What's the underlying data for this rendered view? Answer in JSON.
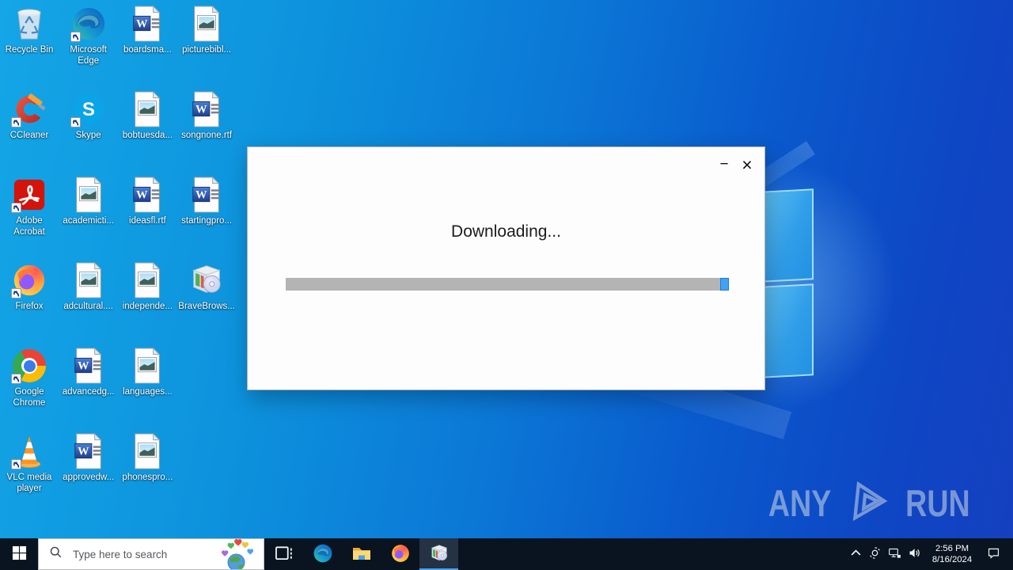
{
  "desktop_icons": [
    {
      "name": "recycle-bin",
      "label": "Recycle Bin",
      "type": "recycle-bin",
      "shortcut": false,
      "col": 1,
      "row": 1
    },
    {
      "name": "microsoft-edge",
      "label": "Microsoft Edge",
      "type": "edge",
      "shortcut": true,
      "col": 2,
      "row": 1
    },
    {
      "name": "boardsma-doc",
      "label": "boardsma...",
      "type": "word",
      "shortcut": false,
      "col": 3,
      "row": 1
    },
    {
      "name": "picturebibl-image",
      "label": "picturebibl...",
      "type": "image",
      "shortcut": false,
      "col": 4,
      "row": 1
    },
    {
      "name": "ccleaner",
      "label": "CCleaner",
      "type": "ccleaner",
      "shortcut": true,
      "col": 1,
      "row": 2
    },
    {
      "name": "skype",
      "label": "Skype",
      "type": "skype",
      "shortcut": true,
      "col": 2,
      "row": 2
    },
    {
      "name": "bobtuesda-image",
      "label": "bobtuesda...",
      "type": "image",
      "shortcut": false,
      "col": 3,
      "row": 2
    },
    {
      "name": "songnone-rtf",
      "label": "songnone.rtf",
      "type": "word",
      "shortcut": false,
      "col": 4,
      "row": 2
    },
    {
      "name": "adobe-acrobat",
      "label": "Adobe Acrobat",
      "type": "acrobat",
      "shortcut": true,
      "col": 1,
      "row": 3
    },
    {
      "name": "academicti-image",
      "label": "academicti...",
      "type": "image",
      "shortcut": false,
      "col": 2,
      "row": 3
    },
    {
      "name": "ideasfl-rtf",
      "label": "ideasfl.rtf",
      "type": "word",
      "shortcut": false,
      "col": 3,
      "row": 3
    },
    {
      "name": "startingpro-doc",
      "label": "startingpro...",
      "type": "word",
      "shortcut": false,
      "col": 4,
      "row": 3
    },
    {
      "name": "firefox",
      "label": "Firefox",
      "type": "firefox",
      "shortcut": true,
      "col": 1,
      "row": 4
    },
    {
      "name": "adcultural-image",
      "label": "adcultural....",
      "type": "image",
      "shortcut": false,
      "col": 2,
      "row": 4
    },
    {
      "name": "independe-image",
      "label": "independe...",
      "type": "image",
      "shortcut": false,
      "col": 3,
      "row": 4
    },
    {
      "name": "bravebrowser-installer",
      "label": "BraveBrows...",
      "type": "installer",
      "shortcut": false,
      "col": 4,
      "row": 4
    },
    {
      "name": "google-chrome",
      "label": "Google Chrome",
      "type": "chrome",
      "shortcut": true,
      "col": 1,
      "row": 5
    },
    {
      "name": "advancedg-doc",
      "label": "advancedg...",
      "type": "word",
      "shortcut": false,
      "col": 2,
      "row": 5
    },
    {
      "name": "languages-image",
      "label": "languages...",
      "type": "image",
      "shortcut": false,
      "col": 3,
      "row": 5
    },
    {
      "name": "vlc-media-player",
      "label": "VLC media player",
      "type": "vlc",
      "shortcut": true,
      "col": 1,
      "row": 6
    },
    {
      "name": "approvedw-doc",
      "label": "approvedw...",
      "type": "word",
      "shortcut": false,
      "col": 2,
      "row": 6
    },
    {
      "name": "phonespro-image",
      "label": "phonespro...",
      "type": "image",
      "shortcut": false,
      "col": 3,
      "row": 6
    }
  ],
  "dialog": {
    "status_text": "Downloading...",
    "controls": {
      "minimize": "−",
      "close": "×"
    },
    "progress": {
      "style": "marquee-block-at-right",
      "track_color": "#b4b4b4",
      "block_color": "#44a2f4"
    }
  },
  "taskbar": {
    "search": {
      "placeholder": "Type here to search"
    },
    "app_icons": [
      "windows-start",
      "task-view",
      "microsoft-edge",
      "file-explorer",
      "firefox",
      "installer"
    ],
    "active_app": "installer",
    "tray_icons": [
      "hidden-icons-chevron",
      "meet-now-camera",
      "network",
      "volume",
      "action-center"
    ],
    "tray": {
      "time": "2:56 PM",
      "date": "8/16/2024"
    }
  },
  "watermark": {
    "left": "ANY",
    "right": "RUN"
  },
  "colors": {
    "wallpaper_left": "#14a6e6",
    "wallpaper_right": "#1540c0",
    "taskbar": "#0a1420",
    "accent_underline": "#4da2e8",
    "logo_pane": "#319ee9",
    "logo_pane_border": "#9fe0fb"
  }
}
